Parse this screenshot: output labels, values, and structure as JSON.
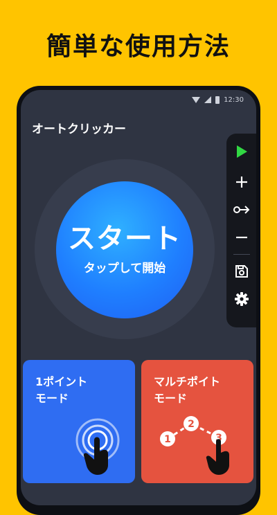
{
  "headline": "簡単な使用方法",
  "status_bar": {
    "time": "12:30"
  },
  "app": {
    "title": "オートクリッカー",
    "start_button": {
      "main_label": "スタート",
      "sub_label": "タップして開始"
    }
  },
  "toolbar": {
    "items": [
      "play-icon",
      "plus-icon",
      "swipe-icon",
      "minus-icon",
      "save-icon",
      "gear-icon"
    ],
    "play_color": "#31d843"
  },
  "modes": {
    "single": {
      "label": "1ポイント\nモード",
      "color": "#2f6df2"
    },
    "multi": {
      "label": "マルチポイト\nモード",
      "color": "#e5533f",
      "steps": [
        "1",
        "2",
        "3"
      ]
    }
  },
  "colors": {
    "background": "#FFC400",
    "screen": "#2f3442",
    "start": "#1f7fff"
  }
}
